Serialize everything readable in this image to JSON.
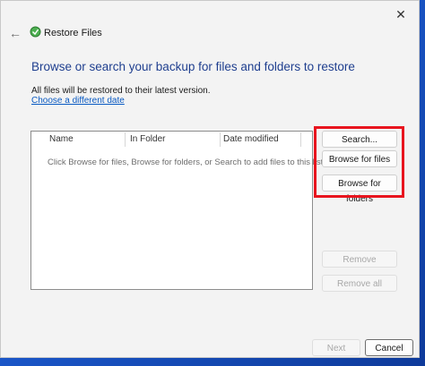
{
  "window": {
    "title": "Restore Files",
    "back_glyph": "←",
    "close_glyph": "✕",
    "back_icon": "back-arrow-icon",
    "close_icon": "close-icon",
    "app_icon": "restore-files-icon"
  },
  "content": {
    "heading": "Browse or search your backup for files and folders to restore",
    "info": "All files will be restored to their latest version.",
    "link": "Choose a different date"
  },
  "file_list": {
    "columns": [
      "Name",
      "In Folder",
      "Date modified"
    ],
    "empty_message": "Click Browse for files, Browse for folders, or Search to add files to this list."
  },
  "side_buttons": {
    "search": "Search...",
    "browse_files": "Browse for files",
    "browse_folders": "Browse for folders",
    "remove": "Remove",
    "remove_all": "Remove all"
  },
  "footer": {
    "next": "Next",
    "cancel": "Cancel"
  },
  "colors": {
    "heading": "#1f3f8f",
    "link": "#0a5ac2",
    "highlight_box": "#e8141e"
  }
}
